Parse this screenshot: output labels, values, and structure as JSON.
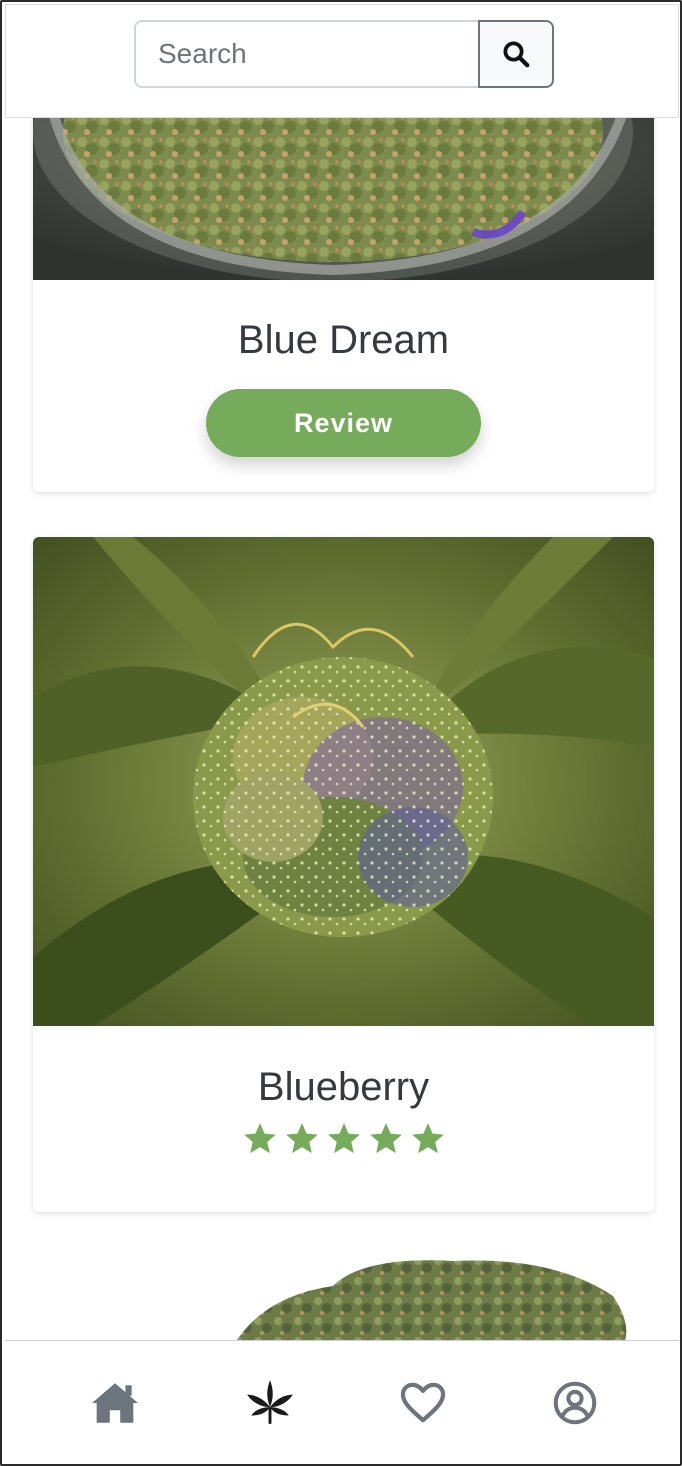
{
  "search": {
    "placeholder": "Search",
    "button_icon": "search-icon"
  },
  "cards": [
    {
      "name": "Blue Dream",
      "action_label": "Review",
      "image": "cannabis-buds-in-jar"
    },
    {
      "name": "Blueberry",
      "rating": 5,
      "rating_max": 5,
      "image": "cannabis-plant-closeup"
    },
    {
      "image": "cannabis-bud-white-background"
    }
  ],
  "bottom_nav": [
    {
      "icon": "home-icon",
      "active": false
    },
    {
      "icon": "leaf-icon",
      "active": true
    },
    {
      "icon": "heart-icon",
      "active": false
    },
    {
      "icon": "user-icon",
      "active": false
    }
  ],
  "colors": {
    "accent_green": "#75ab5b",
    "nav_icon": "#6c757d",
    "nav_icon_active": "#1a1a1a",
    "text": "#343a40"
  }
}
